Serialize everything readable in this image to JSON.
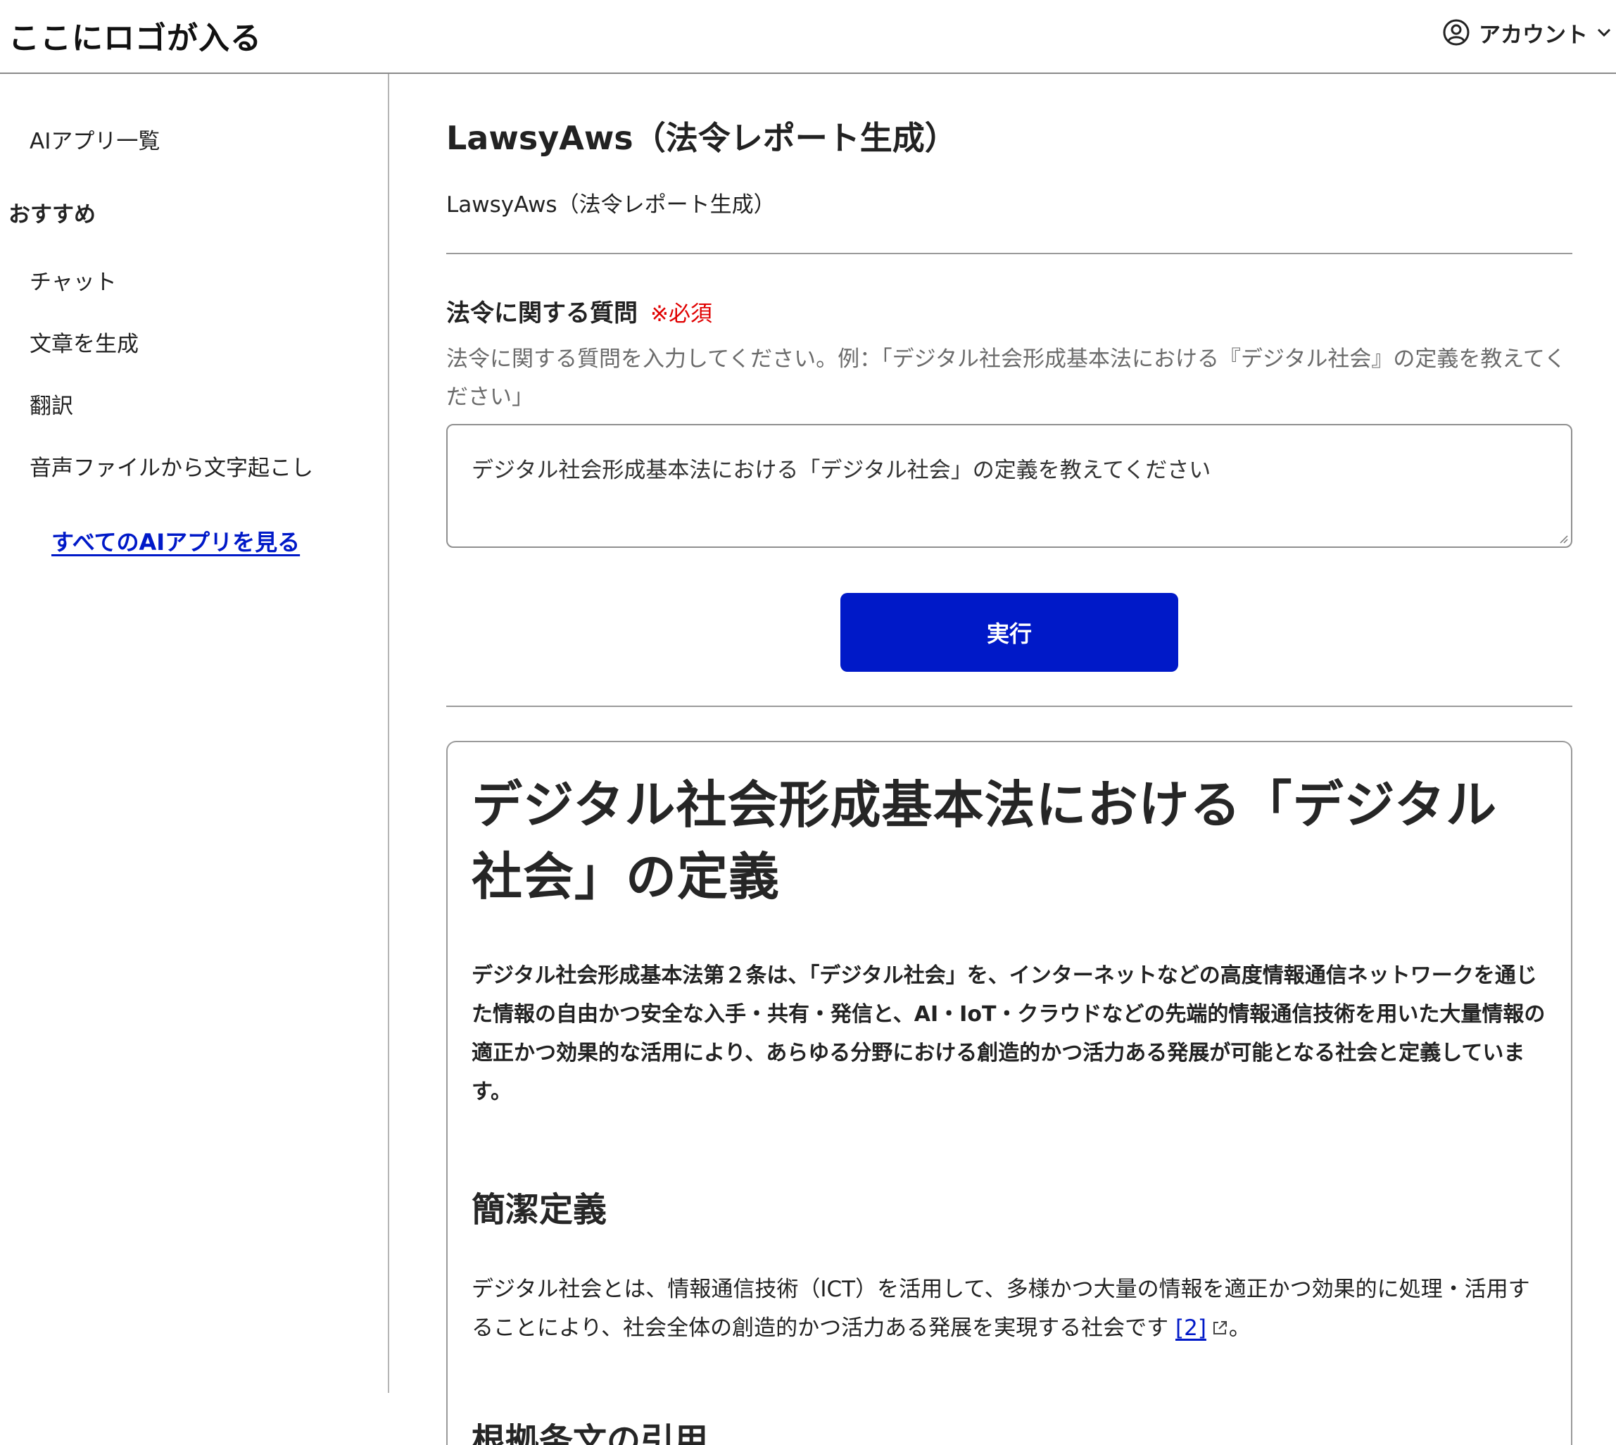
{
  "header": {
    "logo": "ここにロゴが入る",
    "account_label": "アカウント"
  },
  "sidebar": {
    "items": [
      {
        "label": "AIアプリ一覧"
      },
      {
        "label": "チャット"
      },
      {
        "label": "文章を生成"
      },
      {
        "label": "翻訳"
      },
      {
        "label": "音声ファイルから文字起こし"
      }
    ],
    "section_heading": "おすすめ",
    "see_all_link": "すべてのAIアプリを見る"
  },
  "main": {
    "title": "LawsyAws（法令レポート生成）",
    "subtitle": "LawsyAws（法令レポート生成）",
    "field": {
      "label": "法令に関する質問",
      "required": "※必須",
      "help": "法令に関する質問を入力してください。例：「デジタル社会形成基本法における『デジタル社会』の定義を教えてください」",
      "value": "デジタル社会形成基本法における「デジタル社会」の定義を教えてください"
    },
    "run_button": "実行",
    "result": {
      "heading": "デジタル社会形成基本法における「デジタル社会」の定義",
      "summary": "デジタル社会形成基本法第２条は、「デジタル社会」を、インターネットなどの高度情報通信ネットワークを通じた情報の自由かつ安全な入手・共有・発信と、AI・IoT・クラウドなどの先端的情報通信技術を用いた大量情報の適正かつ効果的な活用により、あらゆる分野における創造的かつ活力ある発展が可能となる社会と定義しています。",
      "section1_heading": "簡潔定義",
      "section1_body": "デジタル社会とは、情報通信技術（ICT）を活用して、多様かつ大量の情報を適正かつ効果的に処理・活用することにより、社会全体の創造的かつ活力ある発展を実現する社会です",
      "section1_citation": "[2]",
      "section1_end": "。",
      "section2_heading": "根拠条文の引用"
    }
  }
}
